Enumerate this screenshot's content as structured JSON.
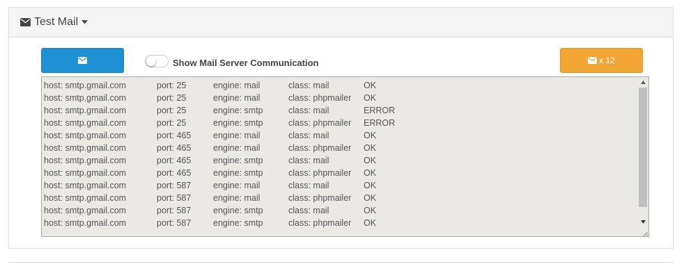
{
  "panel": {
    "title": "Test Mail",
    "title_icon": "envelope-icon",
    "title_caret": "caret-down-icon"
  },
  "toolbar": {
    "send_button_icon": "envelope-icon",
    "toggle_label": "Show Mail Server Communication",
    "toggle_state": "off",
    "multi_button_label": "x 12",
    "multi_button_icon": "envelope-icon"
  },
  "colors": {
    "primary": "#1e90d4",
    "warning": "#f0a535",
    "output_bg": "#ebe9e4"
  },
  "output": {
    "rows": [
      {
        "host": "host: smtp.gmail.com",
        "port": "port: 25",
        "engine": "engine: mail",
        "class": "class: mail",
        "status": "OK"
      },
      {
        "host": "host: smtp.gmail.com",
        "port": "port: 25",
        "engine": "engine: mail",
        "class": "class: phpmailer",
        "status": "OK"
      },
      {
        "host": "host: smtp.gmail.com",
        "port": "port: 25",
        "engine": "engine: smtp",
        "class": "class: mail",
        "status": "ERROR"
      },
      {
        "host": "host: smtp.gmail.com",
        "port": "port: 25",
        "engine": "engine: smtp",
        "class": "class: phpmailer",
        "status": "ERROR"
      },
      {
        "host": "host: smtp.gmail.com",
        "port": "port: 465",
        "engine": "engine: mail",
        "class": "class: mail",
        "status": "OK"
      },
      {
        "host": "host: smtp.gmail.com",
        "port": "port: 465",
        "engine": "engine: mail",
        "class": "class: phpmailer",
        "status": "OK"
      },
      {
        "host": "host: smtp.gmail.com",
        "port": "port: 465",
        "engine": "engine: smtp",
        "class": "class: mail",
        "status": "OK"
      },
      {
        "host": "host: smtp.gmail.com",
        "port": "port: 465",
        "engine": "engine: smtp",
        "class": "class: phpmailer",
        "status": "OK"
      },
      {
        "host": "host: smtp.gmail.com",
        "port": "port: 587",
        "engine": "engine: mail",
        "class": "class: mail",
        "status": "OK"
      },
      {
        "host": "host: smtp.gmail.com",
        "port": "port: 587",
        "engine": "engine: mail",
        "class": "class: phpmailer",
        "status": "OK"
      },
      {
        "host": "host: smtp.gmail.com",
        "port": "port: 587",
        "engine": "engine: smtp",
        "class": "class: mail",
        "status": "OK"
      },
      {
        "host": "host: smtp.gmail.com",
        "port": "port: 587",
        "engine": "engine: smtp",
        "class": "class: phpmailer",
        "status": "OK"
      }
    ]
  }
}
